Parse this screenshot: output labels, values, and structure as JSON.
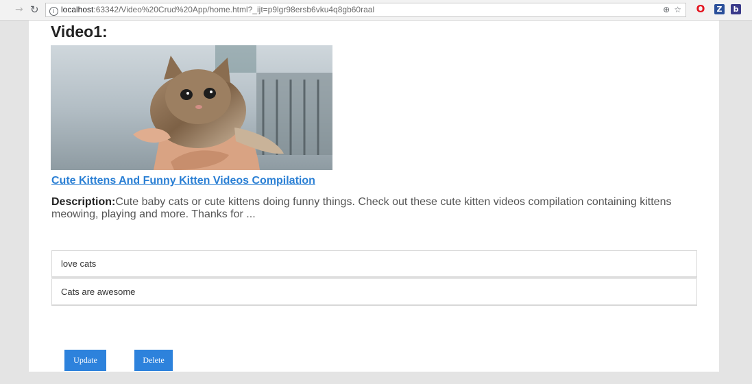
{
  "browser": {
    "url_host": "localhost",
    "url_rest": ":63342/Video%20Crud%20App/home.html?_ijt=p9lgr98ersb6vku4q8gb60raal",
    "info_glyph": "i",
    "zoom_icon": "zoom-icon",
    "star_icon": "bookmark-star-icon",
    "extensions": {
      "opera_glyph": "O",
      "z_glyph": "Z",
      "b_glyph": "b"
    }
  },
  "video": {
    "title": "Video1:",
    "thumbnail": "kitten-thumbnail",
    "link_text": "Cute Kittens And Funny Kitten Videos Compilation ",
    "description_label": "Description:",
    "description_text": "Cute baby cats or cute kittens doing funny things. Check out these cute kitten videos compilation containing kittens meowing, playing and more. Thanks for ..."
  },
  "comments": [
    {
      "text": "love cats"
    },
    {
      "text": "Cats are awesome"
    }
  ],
  "actions": {
    "update_label": "Update",
    "delete_label": "Delete"
  },
  "colors": {
    "link": "#2a7fd4",
    "button": "#2d82dc",
    "page_background": "#e4e4e4"
  }
}
